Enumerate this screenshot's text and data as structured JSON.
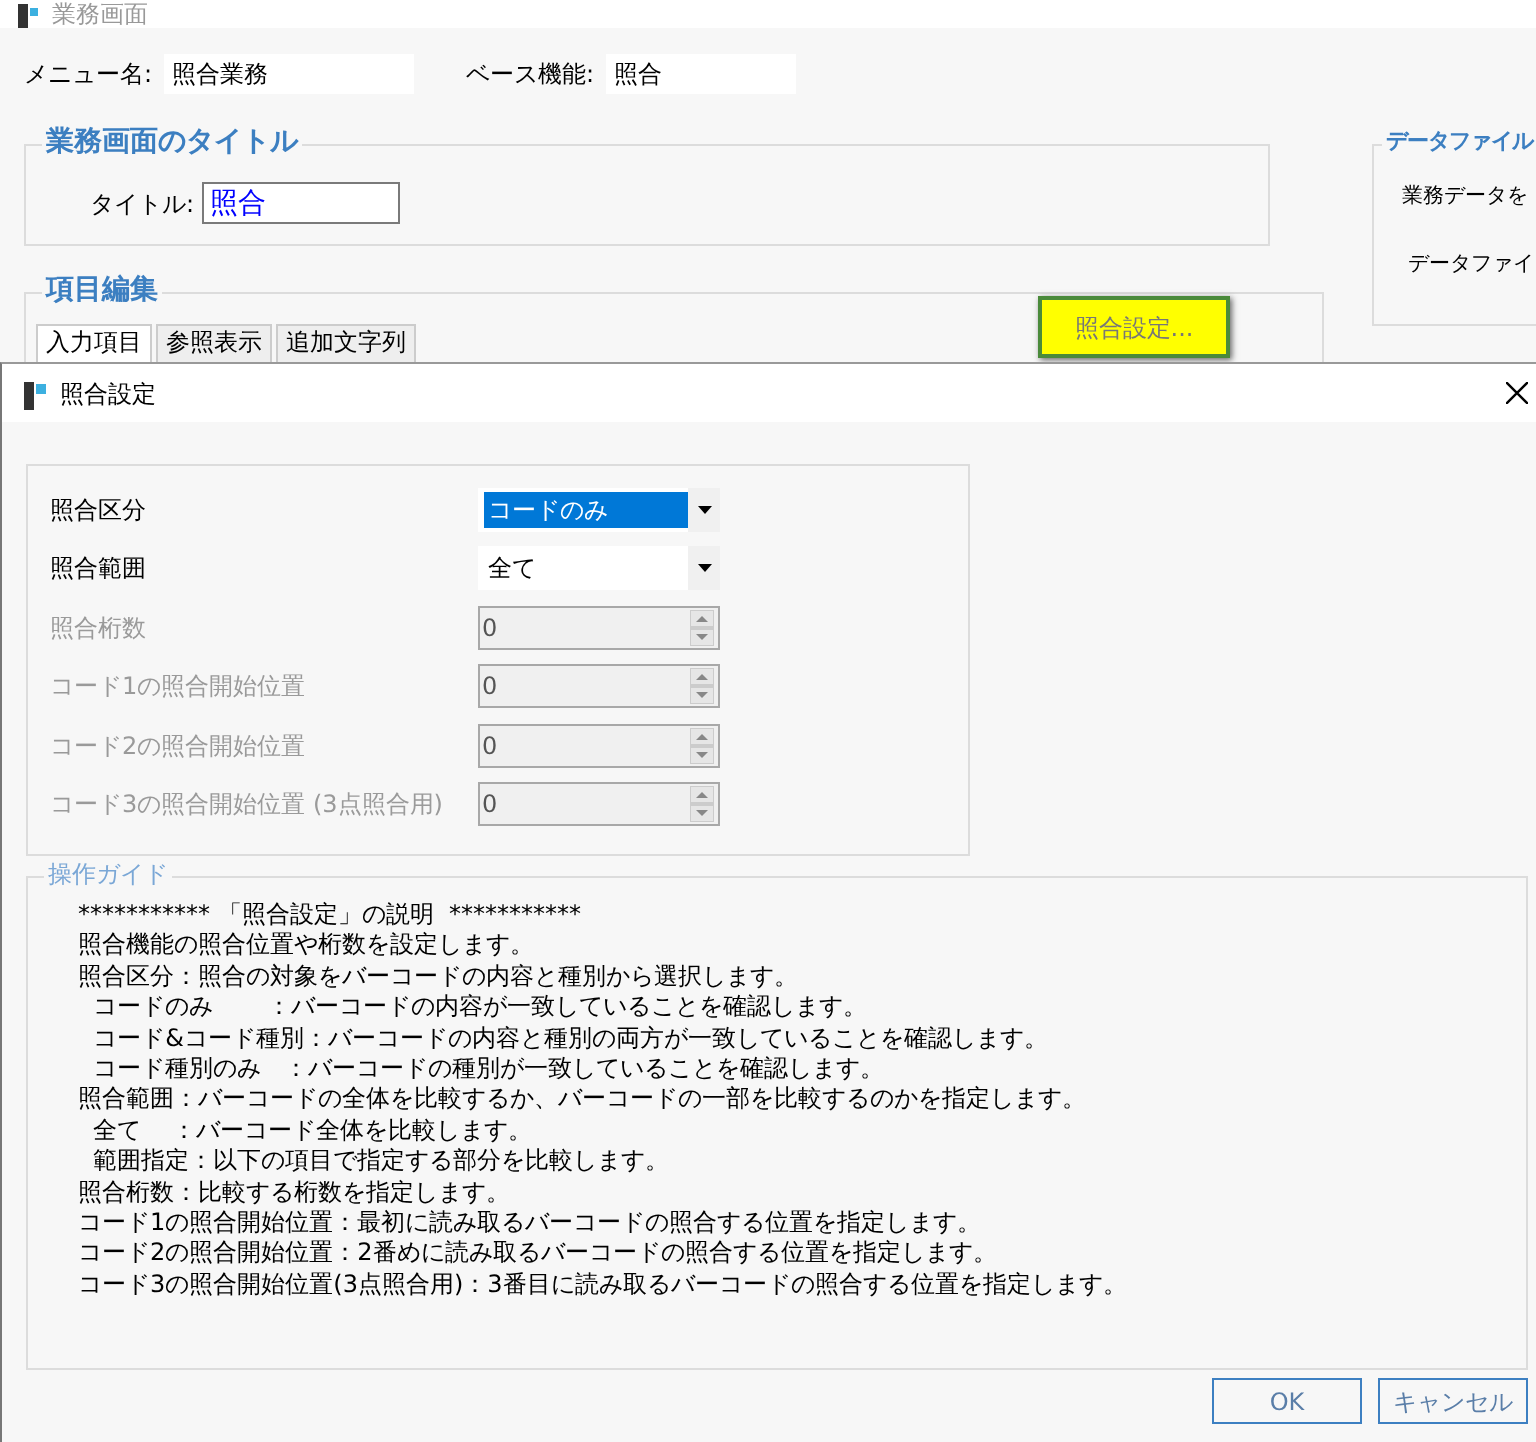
{
  "background_window": {
    "title": "業務画面",
    "menu_name_label": "メニュー名:",
    "menu_name": "照合業務",
    "base_function_label": "ベース機能:",
    "base_function": "照合",
    "title_group": {
      "legend": "業務画面のタイトル",
      "label": "タイトル:",
      "value": "照合"
    },
    "data_file_group": {
      "legend": "データファイル",
      "lines": [
        "業務データを",
        "データファイ"
      ]
    },
    "item_edit_group": {
      "legend": "項目編集",
      "settings_button": "照合設定...",
      "tabs": [
        {
          "label": "入力項目",
          "selected": true
        },
        {
          "label": "参照表示",
          "selected": false
        },
        {
          "label": "追加文字列",
          "selected": false
        }
      ]
    }
  },
  "dialog": {
    "title": "照合設定",
    "fields": [
      {
        "kind": "combo",
        "label": "照合区分",
        "value": "コードのみ",
        "highlighted": true,
        "disabled": false
      },
      {
        "kind": "combo",
        "label": "照合範囲",
        "value": "全て",
        "highlighted": false,
        "disabled": false
      },
      {
        "kind": "spin",
        "label": "照合桁数",
        "value": "0",
        "disabled": true
      },
      {
        "kind": "spin",
        "label": "コード1の照合開始位置",
        "value": "0",
        "disabled": true
      },
      {
        "kind": "spin",
        "label": "コード2の照合開始位置",
        "value": "0",
        "disabled": true
      },
      {
        "kind": "spin",
        "label": "コード3の照合開始位置 (3点照合用)",
        "value": "0",
        "disabled": true
      }
    ],
    "guide": {
      "legend": "操作ガイド",
      "lines": [
        "*********** 「照合設定」の説明  ***********",
        "照合機能の照合位置や桁数を設定します。",
        "照合区分：照合の対象をバーコードの内容と種別から選択します。",
        "  コードのみ       ：バーコードの内容が一致していることを確認します。",
        "  コード&コード種別：バーコードの内容と種別の両方が一致していることを確認します。",
        "  コード種別のみ   ：バーコードの種別が一致していることを確認します。",
        "照合範囲：バーコードの全体を比較するか、バーコードの一部を比較するのかを指定します。",
        "  全て    ：バーコード全体を比較します。",
        "  範囲指定：以下の項目で指定する部分を比較します。",
        "照合桁数：比較する桁数を指定します。",
        "コード1の照合開始位置：最初に読み取るバーコードの照合する位置を指定します。",
        "コード2の照合開始位置：2番めに読み取るバーコードの照合する位置を指定します。",
        "コード3の照合開始位置(3点照合用)：3番目に読み取るバーコードの照合する位置を指定します。"
      ]
    },
    "buttons": [
      "OK",
      "キャンセル"
    ]
  }
}
